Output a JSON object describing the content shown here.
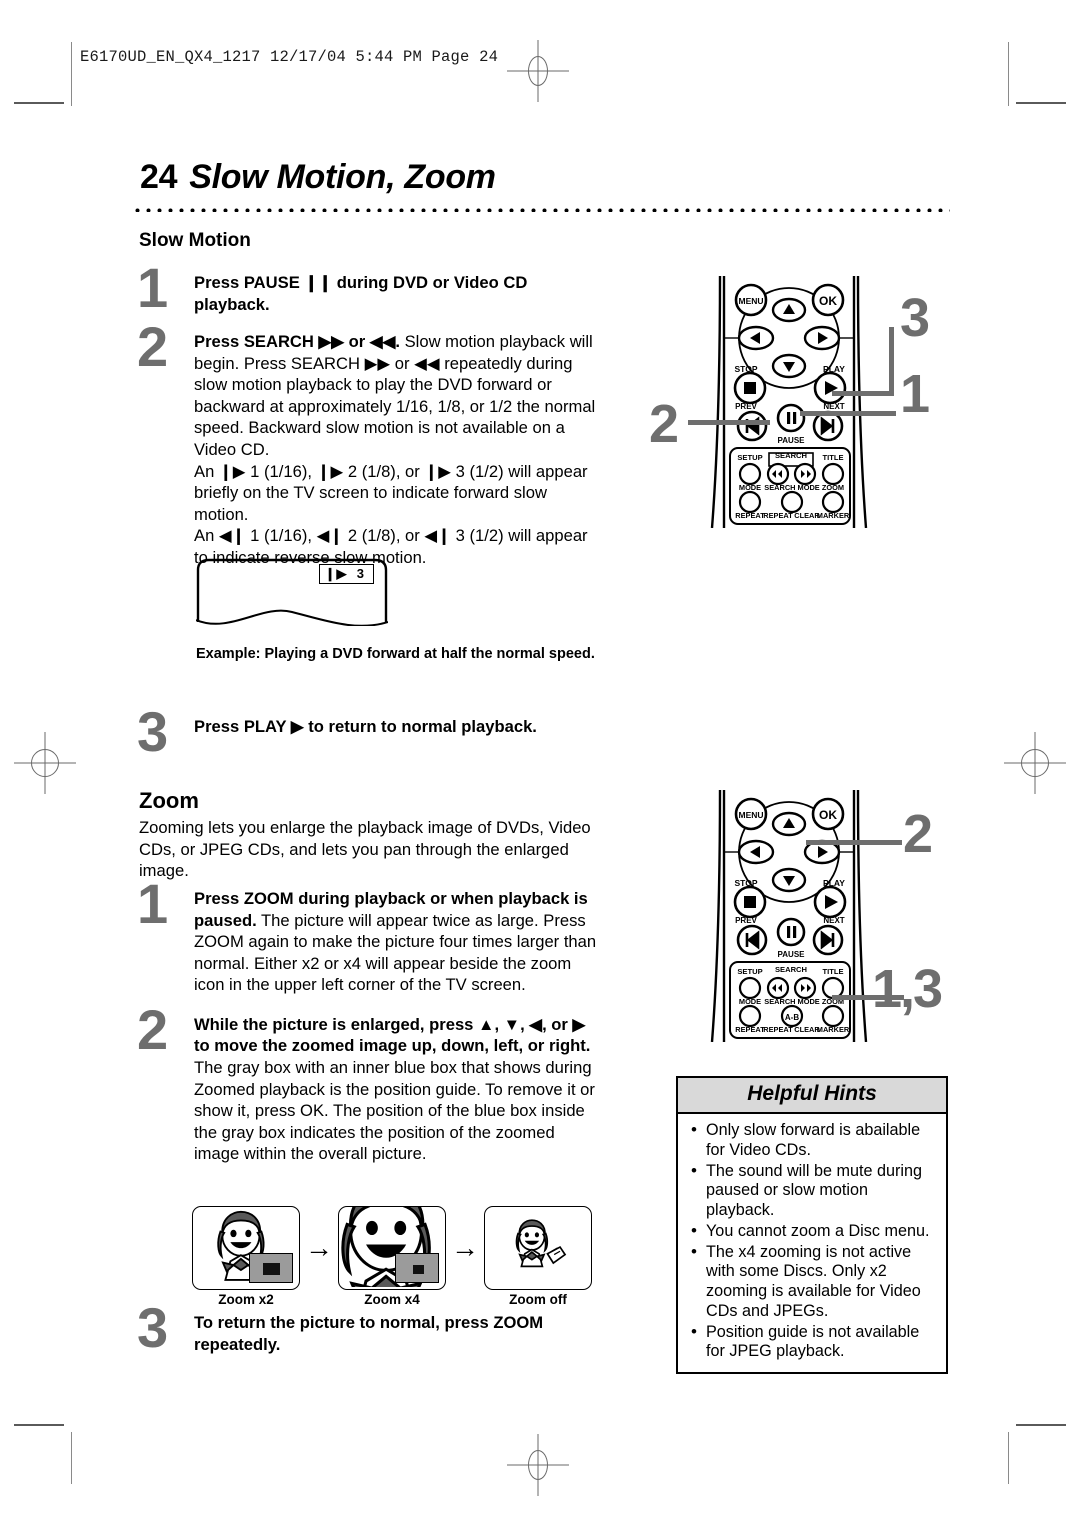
{
  "print_slug": "E6170UD_EN_QX4_1217   12/17/04   5:44 PM   Page 24",
  "page": {
    "number": "24",
    "title": "Slow Motion, Zoom"
  },
  "slow_motion": {
    "heading": "Slow Motion",
    "steps": [
      {
        "num": "1",
        "bold_lead": "Press PAUSE ❙❙ during DVD or Video CD playback.",
        "body": ""
      },
      {
        "num": "2",
        "bold_lead": "Press SEARCH ▶▶ or ◀◀.",
        "body": " Slow motion playback will begin. Press SEARCH ▶▶ or ◀◀ repeatedly during slow motion playback to play the DVD forward or backward at approximately 1/16, 1/8, or 1/2 the normal speed. Backward slow motion is not available on a Video CD.",
        "body2": "An ❙▶ 1 (1/16), ❙▶ 2 (1/8), or ❙▶ 3 (1/2) will appear briefly on the TV screen to indicate forward slow motion.",
        "body3": "An ◀❙ 1 (1/16), ◀❙ 2 (1/8), or ◀❙ 3 (1/2) will appear to indicate reverse slow motion."
      },
      {
        "num": "3",
        "bold_lead": "Press PLAY ▶ to return to normal playback.",
        "body": ""
      }
    ],
    "tv_example": {
      "indicator": "3",
      "indicator_icon": "slow-forward-icon",
      "caption": "Example: Playing a DVD forward at half the normal speed."
    },
    "callouts": [
      "3",
      "1",
      "2"
    ]
  },
  "zoom": {
    "heading": "Zoom",
    "intro": "Zooming lets you enlarge the playback image of DVDs, Video CDs, or JPEG CDs, and lets you pan through the enlarged image.",
    "steps": [
      {
        "num": "1",
        "bold_lead": "Press ZOOM during playback or when playback is paused.",
        "body": " The picture will appear twice as large. Press ZOOM again to make the picture four times larger than normal. Either x2 or x4 will appear beside the zoom icon in the upper left corner of the TV screen."
      },
      {
        "num": "2",
        "bold_lead": "While the picture is enlarged, press ▲, ▼, ◀, or ▶ to move the zoomed image up, down, left, or right.",
        "body": "The gray box with an inner blue box that shows during Zoomed playback is the position guide. To remove it or show it, press OK. The position of the blue box inside the gray box indicates the position of the zoomed image within the overall picture."
      },
      {
        "num": "3",
        "bold_lead": "To return the picture to normal, press ZOOM repeatedly.",
        "body": ""
      }
    ],
    "illustrations": [
      {
        "caption": "Zoom x2"
      },
      {
        "caption": "Zoom x4"
      },
      {
        "caption": "Zoom off"
      }
    ],
    "arrows": [
      "→",
      "→"
    ],
    "callouts": [
      "2",
      "1,3"
    ]
  },
  "helpful_hints": {
    "title": "Helpful Hints",
    "items": [
      "Only slow forward is abailable for Video CDs.",
      "The sound will be mute during paused or slow motion playback.",
      "You cannot zoom a Disc menu.",
      "The x4 zooming is not active with some Discs. Only x2 zooming is available for Video CDs and JPEGs.",
      "Position guide is not available for JPEG playback."
    ]
  },
  "remote": {
    "buttons": {
      "menu": "MENU",
      "ok": "OK",
      "stop": "STOP",
      "play": "PLAY",
      "prev": "PREV",
      "pause": "PAUSE",
      "next": "NEXT",
      "setup": "SETUP",
      "search": "SEARCH",
      "title": "TITLE",
      "mode": "MODE",
      "search_mode": "SEARCH MODE",
      "zoom": "ZOOM",
      "repeat": "REPEAT",
      "repeat_ab": "REPEAT",
      "repeat_ab_label": "A-B",
      "clear": "CLEAR",
      "marker": "MARKER"
    }
  },
  "colors": {
    "callout_gray": "#6e6e6e",
    "hint_header_bg": "#d9d9d9",
    "position_guide_gray": "#9b9b9b"
  }
}
